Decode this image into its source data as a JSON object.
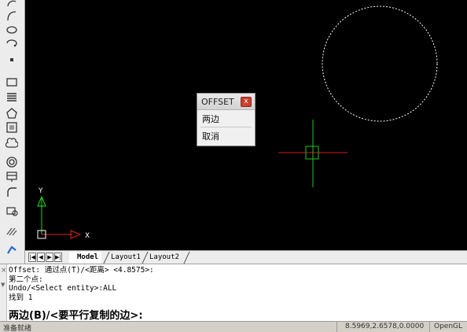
{
  "popup": {
    "title": "OFFSET",
    "close_glyph": "x",
    "items": [
      "两边",
      "取消"
    ]
  },
  "ucs": {
    "x_label": "X",
    "y_label": "Y"
  },
  "tabs": {
    "nav": [
      "first",
      "prev",
      "next",
      "last"
    ],
    "labels": [
      "Model",
      "Layout1",
      "Layout2"
    ],
    "active": "Model"
  },
  "command": {
    "lines": [
      "Offset: 通过点(T)/<距离> <4.8575>:",
      "第二个点:",
      "Undo/<Select entity>:ALL",
      "找到 1"
    ],
    "prompt": "两边(B)/<要平行复制的边>:"
  },
  "status": {
    "ready": "准备就绪",
    "coords": "8.5969,2.6578,0.0000",
    "renderer": "OpenGL"
  },
  "colors": {
    "canvas_bg": "#000000",
    "crosshair_h": "#d01a1a",
    "crosshair_v": "#1ec81e",
    "ucs_x": "#e02020",
    "ucs_y": "#20e020",
    "circle": "#ffffff",
    "popup_close": "#c9402d"
  },
  "toolbar_icons": [
    "arc-icon",
    "spline-icon",
    "ellipse-icon",
    "ellipse-arc-icon",
    "point-icon",
    "rectangle-icon",
    "hatch-icon",
    "polygon-icon",
    "region-icon",
    "revision-cloud-icon",
    "donut-icon",
    "table-icon",
    "fillet-icon",
    "block-icon",
    "gradient-icon",
    "array-icon"
  ]
}
